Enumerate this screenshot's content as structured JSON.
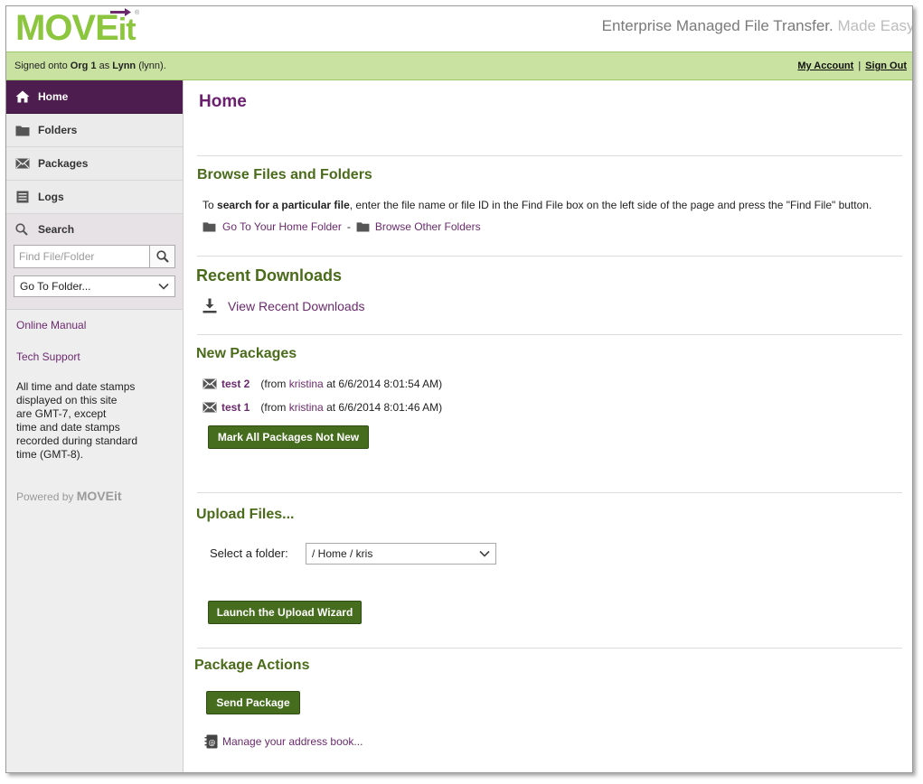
{
  "header": {
    "logo_main": "MOVE",
    "logo_it": "it",
    "tagline": "Enterprise Managed File Transfer.",
    "tagline_easy": "Made Easy."
  },
  "userbar": {
    "prefix": "Signed onto",
    "org": "Org 1",
    "as": "as",
    "user": "Lynn",
    "username": "(lynn).",
    "my_account": "My Account",
    "separator": "|",
    "sign_out": "Sign Out"
  },
  "sidebar": {
    "nav": [
      {
        "label": "Home",
        "icon": "home-icon",
        "active": true
      },
      {
        "label": "Folders",
        "icon": "folder-icon",
        "active": false
      },
      {
        "label": "Packages",
        "icon": "envelope-icon",
        "active": false
      },
      {
        "label": "Logs",
        "icon": "log-icon",
        "active": false
      }
    ],
    "search_label": "Search",
    "find_placeholder": "Find File/Folder",
    "goto_label": "Go To Folder...",
    "online_manual": "Online Manual",
    "tech_support": "Tech Support",
    "note_lines": [
      "All time and date stamps",
      "displayed on this site",
      "are GMT-7, except",
      "time and date stamps",
      "recorded during standard",
      "time (GMT-8)."
    ],
    "powered_by": "Powered by",
    "powered_brand": "MOVEit"
  },
  "main": {
    "page_title": "Home",
    "browse": {
      "title": "Browse Files and Folders",
      "text_pre": "To",
      "text_bold": "search for a particular file",
      "text_post": ", enter the file name or file ID in the Find File box on the left side of the page and press the \"Find File\" button.",
      "home_folder_link": "Go To Your Home Folder",
      "dash": "-",
      "other_folders_link": "Browse Other Folders"
    },
    "downloads": {
      "title": "Recent Downloads",
      "link": "View Recent Downloads"
    },
    "packages": {
      "title": "New Packages",
      "items": [
        {
          "name": "test 2",
          "from_pre": "(from",
          "from_user": "kristina",
          "from_post": "at 6/6/2014 8:01:54 AM)"
        },
        {
          "name": "test 1",
          "from_pre": "(from",
          "from_user": "kristina",
          "from_post": "at 6/6/2014 8:01:46 AM)"
        }
      ],
      "mark_button": "Mark All Packages Not New"
    },
    "upload": {
      "title": "Upload Files...",
      "select_label": "Select a folder:",
      "selected_folder": "/ Home / kris",
      "launch_button": "Launch the Upload Wizard"
    },
    "actions": {
      "title": "Package Actions",
      "send_button": "Send Package",
      "address_book_link": "Manage your address book..."
    }
  },
  "colors": {
    "brand_green": "#8cc63f",
    "bar_green": "#c9e2a2",
    "nav_active": "#4e1d4f",
    "title_purple": "#6b1f6e",
    "section_green": "#4a6b1a",
    "button_green": "#466c1e"
  }
}
